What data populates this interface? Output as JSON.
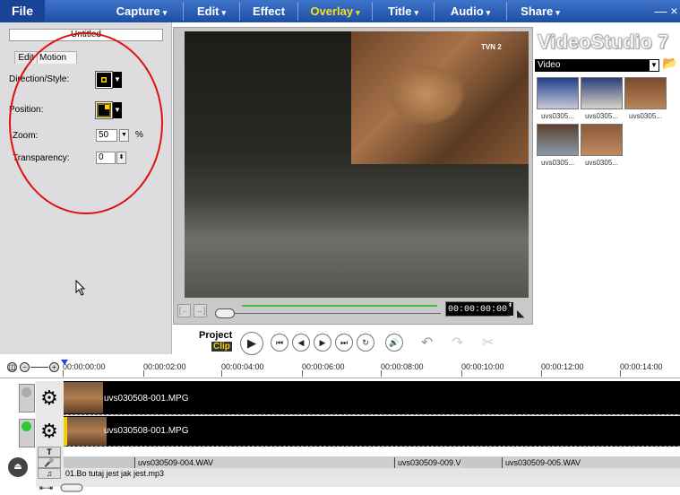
{
  "menu": {
    "file": "File"
  },
  "steps": [
    {
      "label": "Capture",
      "chev": "▾"
    },
    {
      "label": "Edit",
      "chev": "▾"
    },
    {
      "label": "Effect",
      "chev": ""
    },
    {
      "label": "Overlay",
      "chev": "▾"
    },
    {
      "label": "Title",
      "chev": "▾"
    },
    {
      "label": "Audio",
      "chev": "▾"
    },
    {
      "label": "Share",
      "chev": "▾"
    }
  ],
  "window": {
    "minimize": "— ×"
  },
  "options": {
    "title_value": "Untitled",
    "tabs": [
      "Edit",
      "Motion"
    ],
    "direction_label": "Direction/Style:",
    "position_label": "Position:",
    "zoom_label": "Zoom:",
    "zoom_value": "50",
    "zoom_unit": "%",
    "transparency_label": "Transparency:",
    "transparency_value": "0"
  },
  "preview": {
    "channel_logo": "TVN 2",
    "timecode": "00:00:00:00",
    "btn_start": "[←",
    "btn_end": "→]"
  },
  "library": {
    "brand": "VideoStudio 7",
    "category": "Video",
    "items": [
      {
        "caption": "uvs0305...",
        "c1": "#1d3f8a",
        "c2": "#c8c8d8"
      },
      {
        "caption": "uvs0305...",
        "c1": "#2a3e78",
        "c2": "#d8d2c8"
      },
      {
        "caption": "uvs0305...",
        "c1": "#7a4a2c",
        "c2": "#b88658"
      },
      {
        "caption": "uvs0305...",
        "c1": "#5a4030",
        "c2": "#8a9aa8"
      },
      {
        "caption": "uvs0305...",
        "c1": "#8a5a3a",
        "c2": "#c08a5e"
      }
    ]
  },
  "playback": {
    "project": "Project",
    "clip": "Clip"
  },
  "timeline": {
    "ticks": [
      "00:00:00:00",
      "00:00:02:00",
      "00:00:04:00",
      "00:00:06:00",
      "00:00:08:00",
      "00:00:10:00",
      "00:00:12:00",
      "00:00:14:00"
    ],
    "video_clip": "uvs030508-001.MPG",
    "overlay_clip": "uvs030508-001.MPG",
    "audio_clips": [
      "uvs030509-004.WAV",
      "uvs030509-009.V",
      "uvs030509-005.WAV"
    ],
    "music_clip": "01.Bo tutaj jest jak jest.mp3",
    "track_labels": {
      "title": "T",
      "voice": "🎤",
      "music": "♫"
    }
  }
}
